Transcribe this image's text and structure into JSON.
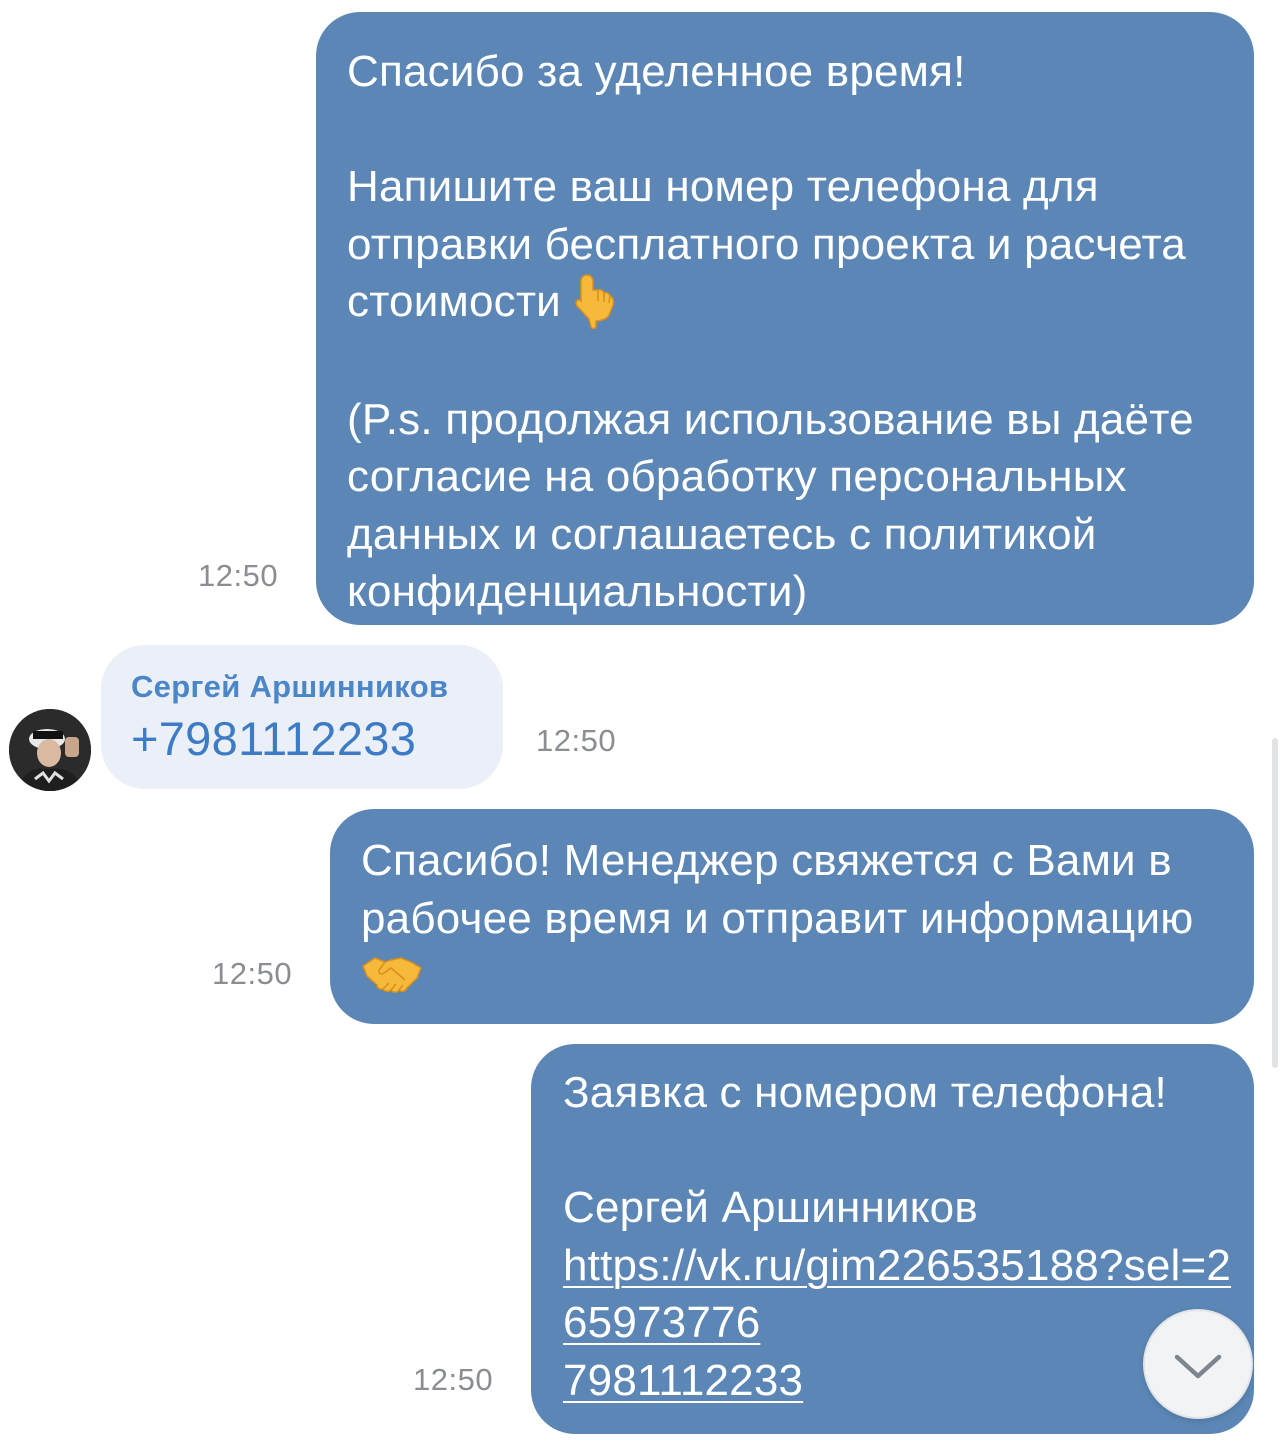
{
  "messages": [
    {
      "paragraphs": [
        "Спасибо за уделенное время!",
        "Напишите ваш номер телефона для отправки бесплатного проекта и расчета стоимости",
        "(P.s. продолжая использование вы даёте согласие на обработку персональных данных и соглашаетесь с политикой конфиденциальности)"
      ],
      "time": "12:50"
    },
    {
      "sender": "Сергей Аршинников",
      "text": "+7981112233",
      "time": "12:50"
    },
    {
      "paragraphs": [
        "Спасибо! Менеджер свяжется с Вами в рабочее время и отправит информацию"
      ],
      "time": "12:50"
    },
    {
      "paragraphs": [
        "Заявка с номером телефона!",
        "Сергей Аршинников",
        "https://vk.ru/gim226535188?sel=265973776",
        "7981112233"
      ],
      "time": "12:50"
    }
  ],
  "icons": {
    "emoji_1": "backhand-index-pointing-down-icon",
    "emoji_2": "handshake-icon",
    "scroll_button": "chevron-down-icon",
    "avatar": "avatar"
  },
  "colors": {
    "outgoing_bubble": "#5b86b5",
    "incoming_bubble": "#ebeff8",
    "link": "#3d7cc4",
    "timestamp": "#8a8d91"
  }
}
